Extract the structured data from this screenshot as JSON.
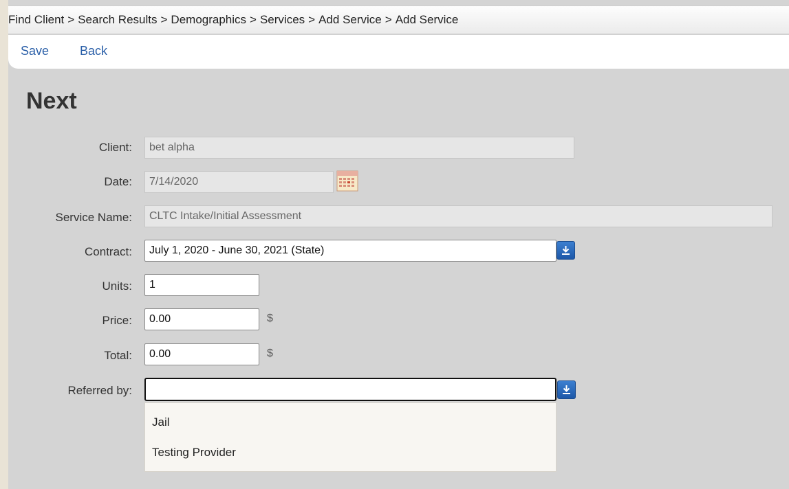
{
  "breadcrumb": {
    "items": [
      "Find Client",
      "Search Results",
      "Demographics",
      "Services",
      "Add Service",
      "Add Service"
    ],
    "separator": ">"
  },
  "toolbar": {
    "save_label": "Save",
    "back_label": "Back"
  },
  "page": {
    "title": "Next"
  },
  "form": {
    "client": {
      "label": "Client:",
      "value": "bet alpha"
    },
    "date": {
      "label": "Date:",
      "value": "7/14/2020"
    },
    "service_name": {
      "label": "Service Name:",
      "value": "CLTC Intake/Initial Assessment"
    },
    "contract": {
      "label": "Contract:",
      "value": "July 1, 2020 - June 30, 2021 (State)"
    },
    "units": {
      "label": "Units:",
      "value": "1"
    },
    "price": {
      "label": "Price:",
      "value": "0.00",
      "unit": "$"
    },
    "total": {
      "label": "Total:",
      "value": "0.00",
      "unit": "$"
    },
    "referred_by": {
      "label": "Referred by:",
      "value": "",
      "options": [
        "Jail",
        "Testing Provider"
      ]
    }
  },
  "icons": {
    "calendar": "calendar-icon",
    "dropdown": "download-arrow-icon"
  },
  "colors": {
    "link": "#2a5fa8",
    "dropdown_button": "#2a6cc0",
    "background": "#d4d4d4"
  }
}
